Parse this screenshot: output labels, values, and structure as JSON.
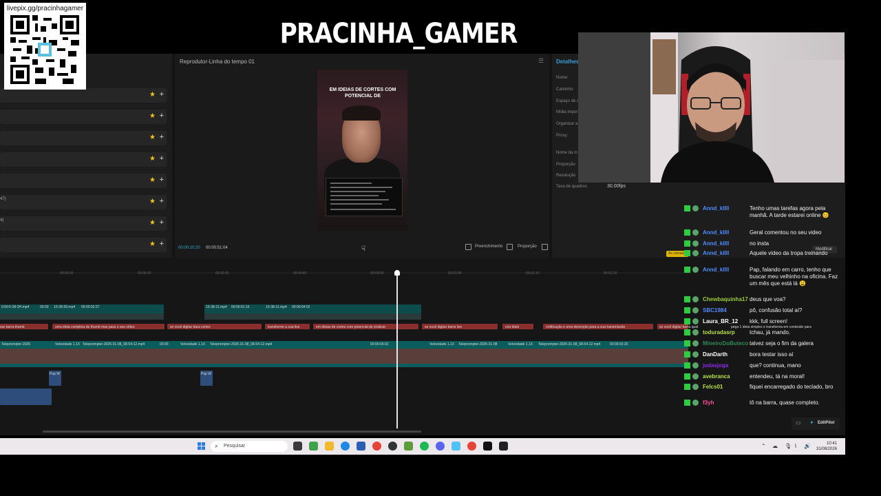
{
  "stream": {
    "title": "PRACINHA_GAMER",
    "qr_url": "livepix.gg/pracinhagamer"
  },
  "editor": {
    "player_title": "Reprodutor-Linha do tempo 01",
    "details_title": "Detalhes",
    "player": {
      "time_current": "00:00:20:20",
      "time_total": "00:00:51:04",
      "fill_label": "Preenchimento",
      "ratio_label": "Proporção"
    },
    "media_labels": [
      "47)",
      "4)"
    ],
    "details_labels": [
      "Nome:",
      "Caminho:",
      "Espaço de c",
      "Mídia impor",
      "Organizar a",
      "Proxy:",
      "Nome da m",
      "Proporção",
      "Resolução",
      "Taxa de quadros:"
    ],
    "fps_value": "30.00fps",
    "modify_label": "Modificar",
    "as_camadas_label": "As camadas"
  },
  "timeline": {
    "video_clips": [
      "0:00:0-28-3H.mp4",
      "00:00",
      "10-28-59.mp4",
      "00:00:02:27",
      "10-38-11.mp4",
      "00:00:01:16",
      "10-38-11.mp4",
      "00:00:04:02"
    ],
    "text_clips": [
      "ear barra thumb",
      "uma ideia completa de thumb mas pass o seu vídeo",
      "se você digitar bara cortes",
      "transforme a sua live",
      "em ideias de cortes com potencial de viralizar",
      "se você digitar barra live",
      "cria título",
      "notificação e uma descrição para a sua transmissão",
      "se você digitar barra qual",
      "pega 1 ideia simples e transforma em conteúdo para"
    ],
    "track_labels": [
      "Teleprompter-2026",
      "Velocidade 1.1X",
      "Teleprompter-2026-31-08_08-54-12.mp4",
      "00:00",
      "Velocidade 1.1X",
      "Teleprompter-2026-31-08_08-54-12.mp4",
      "00:00:04:02",
      "Velocidade 1.1X",
      "Teleprompter-2026-31-08",
      "Velocidade 1.1X",
      "Teleprompter-2026-31-08_08-54-12.mp4",
      "00:00:03:26"
    ],
    "audio_clips": [
      "Pop W",
      "Pop W"
    ],
    "editpilot_label": "EditPilot"
  },
  "video_preview": {
    "caption": "EM IDEIAS DE CORTES COM POTENCIAL DE"
  },
  "chat": [
    {
      "name": "Annd_kllll",
      "text": "Tenho umas tarefas agora pela manhã. A tarde estarei online 😊",
      "color": "#4f8cff"
    },
    {
      "name": "Annd_kllll",
      "text": "Geral comentou no seu video",
      "color": "#4f8cff"
    },
    {
      "name": "Annd_kllll",
      "text": "no insta",
      "color": "#4f8cff"
    },
    {
      "name": "Annd_kllll",
      "text": "Aquele video da tropa treinando",
      "color": "#4f8cff"
    },
    {
      "name": "Annd_kllll",
      "text": "Pap, falando em carro, tenho que buscar meu velhinho na oficina. Faz um mês que está lá 😩",
      "color": "#4f8cff"
    },
    {
      "name": "Chewbaquinha17",
      "text": "deus que voa?",
      "color": "#9acd32"
    },
    {
      "name": "SBC1984",
      "text": "pô, confusão total aí?",
      "color": "#4f8cff"
    },
    {
      "name": "Laura_BR_12",
      "text": "kkk, full screen!",
      "color": "#ffffff"
    },
    {
      "name": "toduradasrp",
      "text": "tchau, já mando.",
      "color": "#b8e040"
    },
    {
      "name": "MineiroDoButeco",
      "text": "talvez seja o fim da galera",
      "color": "#2e8b57"
    },
    {
      "name": "DanDarth",
      "text": "bora testar isso aí",
      "color": "#ffffff"
    },
    {
      "name": "judasjoga",
      "text": "que? continua, mano",
      "color": "#8a2be2"
    },
    {
      "name": "avebranca",
      "text": "entendeu, tá na moral!",
      "color": "#b8e040"
    },
    {
      "name": "Felcs01",
      "text": "fiquei encarregado do teclado, bro",
      "color": "#b8e040"
    },
    {
      "name": "f3yh",
      "text": "tô na barra, quase completo.",
      "color": "#ff4fa0"
    }
  ],
  "taskbar": {
    "search_placeholder": "Pesquisar",
    "time": "10:41",
    "date": "31/08/2026"
  }
}
